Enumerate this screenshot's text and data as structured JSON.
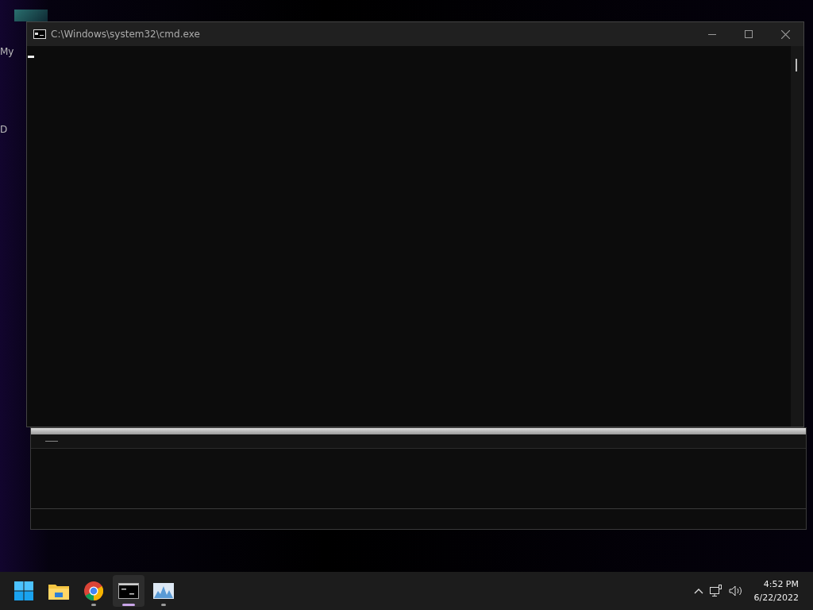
{
  "desktop": {
    "icons": [
      {
        "label": "My"
      },
      {
        "label": "D"
      }
    ]
  },
  "window": {
    "title": "C:\\Windows\\system32\\cmd.exe"
  },
  "taskbar": {
    "apps": [
      {
        "kind": "start",
        "running": false,
        "selected": false
      },
      {
        "kind": "folder",
        "running": false,
        "selected": false
      },
      {
        "kind": "browser",
        "running": true,
        "selected": false
      },
      {
        "kind": "terminal",
        "running": true,
        "selected": true
      },
      {
        "kind": "monitor",
        "running": true,
        "selected": false
      }
    ],
    "clock": {
      "time": "4:52 PM",
      "date": "6/22/2022"
    }
  }
}
